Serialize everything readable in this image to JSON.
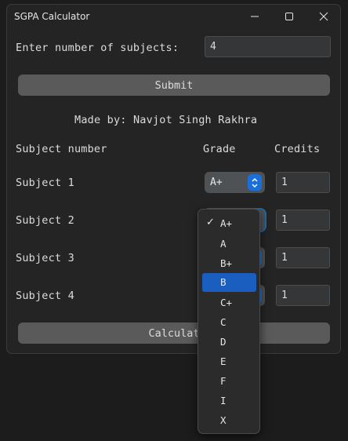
{
  "window": {
    "title": "SGPA Calculator"
  },
  "form": {
    "num_subjects_label": "Enter number of subjects:",
    "num_subjects_value": "4",
    "submit_label": "Submit",
    "credit_line": "Made by: Navjot Singh Rakhra"
  },
  "table": {
    "headers": {
      "subject": "Subject number",
      "grade": "Grade",
      "credits": "Credits"
    },
    "rows": [
      {
        "subject": "Subject 1",
        "grade": "A+",
        "credits": "1"
      },
      {
        "subject": "Subject 2",
        "grade": "",
        "credits": "1"
      },
      {
        "subject": "Subject 3",
        "grade": "",
        "credits": "1"
      },
      {
        "subject": "Subject 4",
        "grade": "",
        "credits": "1"
      }
    ]
  },
  "calculate_label": "Calculat",
  "dropdown": {
    "options": [
      "A+",
      "A",
      "B+",
      "B",
      "C+",
      "C",
      "D",
      "E",
      "F",
      "I",
      "X"
    ],
    "checked": "A+",
    "highlighted": "B"
  },
  "colors": {
    "accent": "#1a6fd8",
    "highlight": "#1a5fbf",
    "button": "#5a5a5a"
  },
  "icons": {
    "minimize": "minimize-icon",
    "maximize": "maximize-icon",
    "close": "close-icon",
    "check": "checkmark-icon"
  }
}
